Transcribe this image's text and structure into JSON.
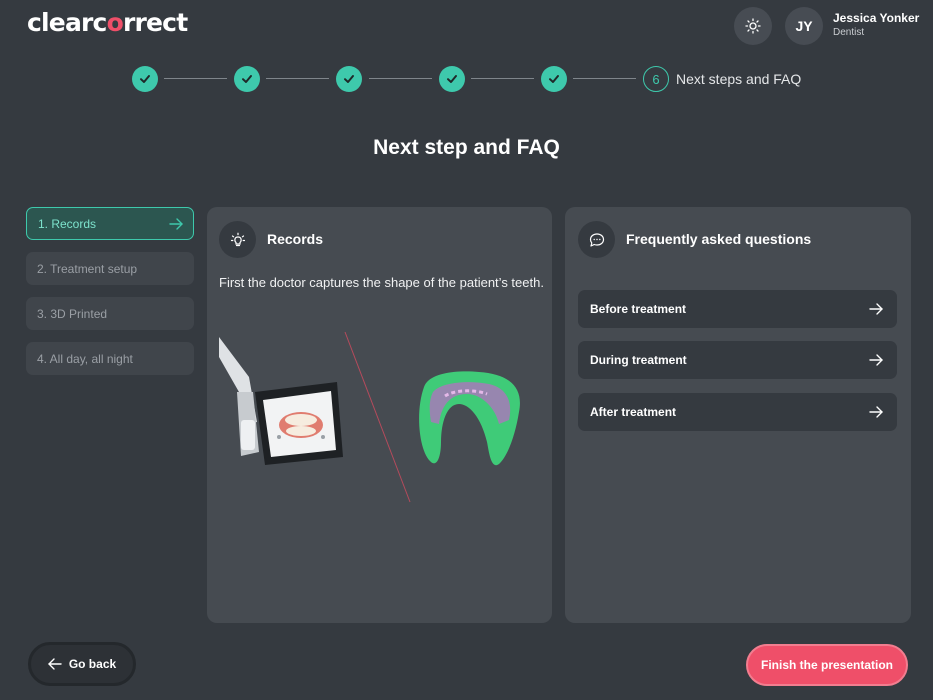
{
  "header": {
    "logo_prefix": "clearc",
    "logo_o": "o",
    "logo_suffix": "rrect",
    "user": {
      "initials": "JY",
      "name": "Jessica Yonker",
      "role": "Dentist"
    }
  },
  "stepper": {
    "completed_steps": 5,
    "current_step_number": "6",
    "current_step_label": "Next steps and FAQ"
  },
  "page_title": "Next step and FAQ",
  "sidebar": {
    "items": [
      {
        "label": "1. Records",
        "active": true
      },
      {
        "label": "2. Treatment setup",
        "active": false
      },
      {
        "label": "3. 3D Printed",
        "active": false
      },
      {
        "label": "4. All day, all night",
        "active": false
      }
    ]
  },
  "records_panel": {
    "title": "Records",
    "text": "First the doctor captures the shape of the patient’s teeth."
  },
  "faq_panel": {
    "title": "Frequently asked questions",
    "items": [
      {
        "label": "Before treatment"
      },
      {
        "label": "During treatment"
      },
      {
        "label": "After treatment"
      }
    ]
  },
  "footer": {
    "go_back": "Go back",
    "finish": "Finish the presentation"
  },
  "colors": {
    "background": "#353a40",
    "panel": "#464b51",
    "accent_teal": "#3ec9ac",
    "brand_pink": "#ef4f69"
  }
}
